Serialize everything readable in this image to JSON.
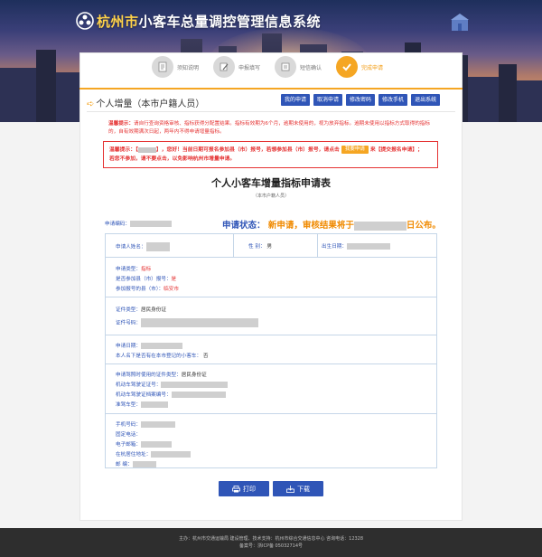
{
  "header": {
    "title_part1": "杭州市",
    "title_part2": "小客车总量调控管理信息系统"
  },
  "steps": [
    {
      "label": "须知说明",
      "state": "done-gray"
    },
    {
      "label": "申报填写",
      "state": "done-gray"
    },
    {
      "label": "短信确认",
      "state": "done-gray"
    },
    {
      "label": "完成申请",
      "state": "current"
    }
  ],
  "section": {
    "title": "个人增量（本市户籍人员）",
    "buttons": [
      "我的申请",
      "取消申请",
      "修改密码",
      "修改手机",
      "退出系统"
    ]
  },
  "tip1": {
    "label": "温馨提示：",
    "text": "请自行查询资格审核、指标获得分配置结果。指标有效期为6个月，逾期未使用的，视为放弃指标。逾期未使用以指标方式取得的指标的，自有效期满次日起，两年内不得申请增量指标。"
  },
  "notice": {
    "label": "温馨提示：",
    "greeting_suffix": "，您好！当前日期可报名参加县（市）报号，若想参加县（市）报号，请点击",
    "button": "我要申请",
    "after_button": "来【提交报名申请】；",
    "line2": "若您不参加，请不要点击，以免影响杭州市增量申请。"
  },
  "form": {
    "title": "个人小客车增量指标申请表",
    "subtitle": "（本市户籍人员）",
    "app_no_label": "申请编码：",
    "status_label": "申请状态：",
    "status_value_prefix": "新申请，审核结果将于",
    "status_value_suffix": "日公布。",
    "applicant_name_label": "申请人姓名：",
    "gender_label": "性 别：",
    "gender_value": "男",
    "birth_label": "出生日期：",
    "apply_type_label": "申请类型：",
    "apply_type_value": "指标",
    "county_label": "是否参加县（市）报号：",
    "county_value": "是",
    "county_reg_label": "参加报号的县（市）：",
    "county_reg_value": "临安市",
    "id_type_label": "证件类型：",
    "id_type_value": "居民身份证",
    "id_no_label": "证件号码：",
    "date_label": "申请日期：",
    "has_car_label": "本人名下是否有在本市登记的小客车：",
    "has_car_value": "否",
    "license_id_type_label": "申请驾照时使用的证件类型：",
    "license_id_type_value": "居民身份证",
    "license_no_label": "机动车驾驶证证号：",
    "license_file_label": "机动车驾驶证档案编号：",
    "license_class_label": "准驾车型：",
    "phone_label": "手机号码：",
    "tel_label": "固定电话：",
    "email_label": "电子邮箱：",
    "address_label": "在杭居住地址：",
    "postcode_label": "邮   编："
  },
  "actions": {
    "print": "打印",
    "download": "下载"
  },
  "footer": {
    "line1": "主办：杭州市交通运输局    建设管理、技术支持：杭州市综合交通信息中心    咨询电话：12328",
    "line2": "备案号：浙ICP备 05032714号"
  },
  "colors": {
    "accent_orange": "#f5a623",
    "primary_blue": "#2f55b7",
    "warning_red": "#e53333"
  }
}
